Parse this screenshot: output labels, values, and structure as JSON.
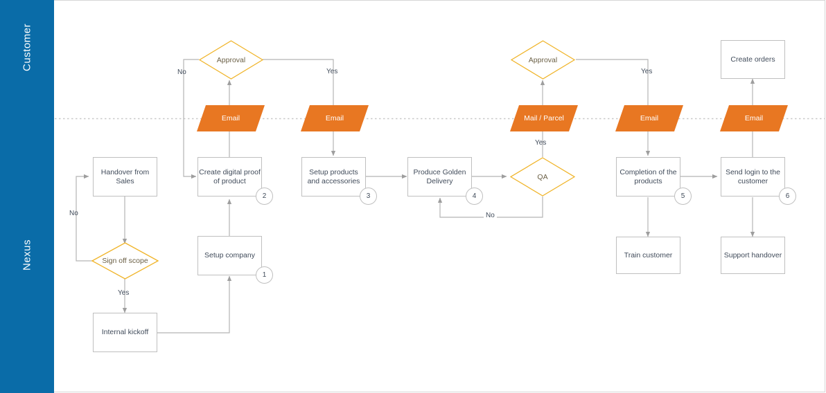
{
  "diagram": {
    "title": "Customer onboarding swimlane flowchart",
    "colors": {
      "lane_blue": "#0A6CA8",
      "orange": "#E87722",
      "diamond_gold": "#F0B429",
      "line_gray": "#b5b5b5",
      "text_dark": "#404B5A",
      "box_border": "#bfbfbf"
    }
  },
  "lanes": [
    {
      "id": "customer",
      "label": "Customer"
    },
    {
      "id": "nexus",
      "label": "Nexus"
    }
  ],
  "decisions": [
    {
      "id": "approval-1",
      "label": "Approval"
    },
    {
      "id": "approval-2",
      "label": "Approval"
    },
    {
      "id": "sign-off-scope",
      "label": "Sign off scope"
    },
    {
      "id": "qa",
      "label": "QA"
    }
  ],
  "messages": [
    {
      "id": "email-1",
      "label": "Email"
    },
    {
      "id": "email-2",
      "label": "Email"
    },
    {
      "id": "mail-parcel",
      "label": "Mail / Parcel"
    },
    {
      "id": "email-3",
      "label": "Email"
    },
    {
      "id": "email-4",
      "label": "Email"
    }
  ],
  "processes": [
    {
      "id": "handover-from-sales",
      "label": "Handover from Sales",
      "badge": null
    },
    {
      "id": "internal-kickoff",
      "label": "Internal kickoff",
      "badge": null
    },
    {
      "id": "setup-company",
      "label": "Setup company",
      "badge": "1"
    },
    {
      "id": "create-digital-proof",
      "label": "Create digital proof of product",
      "badge": "2"
    },
    {
      "id": "setup-products-accessories",
      "label": "Setup products and accessories",
      "badge": "3"
    },
    {
      "id": "produce-golden-delivery",
      "label": "Produce Golden Delivery",
      "badge": "4"
    },
    {
      "id": "completion-of-products",
      "label": "Completion of the products",
      "badge": "5"
    },
    {
      "id": "send-login-to-customer",
      "label": "Send login to the customer",
      "badge": "6"
    },
    {
      "id": "train-customer",
      "label": "Train customer",
      "badge": null
    },
    {
      "id": "support-handover",
      "label": "Support handover",
      "badge": null
    },
    {
      "id": "create-orders",
      "label": "Create orders",
      "badge": null
    }
  ],
  "edge_labels": [
    {
      "id": "no-signoff",
      "label": "No"
    },
    {
      "id": "yes-signoff",
      "label": "Yes"
    },
    {
      "id": "no-approval-1",
      "label": "No"
    },
    {
      "id": "yes-approval-1",
      "label": "Yes"
    },
    {
      "id": "yes-qa",
      "label": "Yes"
    },
    {
      "id": "no-qa",
      "label": "No"
    },
    {
      "id": "yes-approval-2",
      "label": "Yes"
    }
  ]
}
